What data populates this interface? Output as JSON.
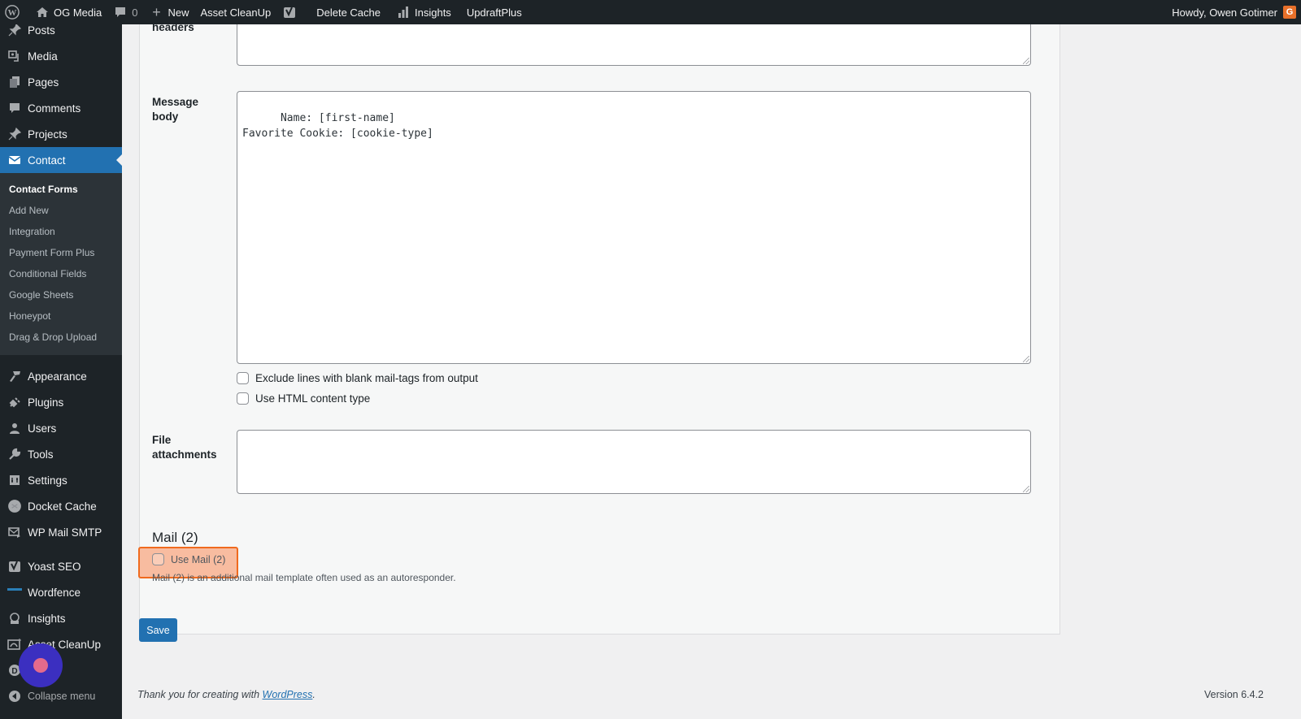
{
  "adminbar": {
    "site_name": "OG Media",
    "comments_count": "0",
    "new_label": "New",
    "asset_cleanup": "Asset CleanUp",
    "delete_cache": "Delete Cache",
    "insights": "Insights",
    "updraftplus": "UpdraftPlus",
    "howdy": "Howdy, Owen Gotimer",
    "avatar_letter": "G"
  },
  "sidebar": {
    "items_top": [
      {
        "label": "Posts",
        "icon": "pin-icon"
      },
      {
        "label": "Media",
        "icon": "media-icon"
      },
      {
        "label": "Pages",
        "icon": "pages-icon"
      },
      {
        "label": "Comments",
        "icon": "comment-icon"
      },
      {
        "label": "Projects",
        "icon": "pin-icon"
      },
      {
        "label": "Contact",
        "icon": "mail-icon",
        "active": true
      }
    ],
    "submenu": [
      {
        "label": "Contact Forms",
        "current": true
      },
      {
        "label": "Add New"
      },
      {
        "label": "Integration"
      },
      {
        "label": "Payment Form Plus"
      },
      {
        "label": "Conditional Fields"
      },
      {
        "label": "Google Sheets"
      },
      {
        "label": "Honeypot"
      },
      {
        "label": "Drag & Drop Upload"
      }
    ],
    "items_mid": [
      {
        "label": "Appearance",
        "icon": "brush-icon"
      },
      {
        "label": "Plugins",
        "icon": "plug-icon"
      },
      {
        "label": "Users",
        "icon": "user-icon"
      },
      {
        "label": "Tools",
        "icon": "wrench-icon"
      },
      {
        "label": "Settings",
        "icon": "settings-icon"
      },
      {
        "label": "Docket Cache",
        "icon": "docket-icon"
      },
      {
        "label": "WP Mail SMTP",
        "icon": "mail-smtp-icon"
      }
    ],
    "items_bottom": [
      {
        "label": "Yoast SEO",
        "icon": "yoast-icon"
      },
      {
        "label": "Wordfence",
        "icon": "wordfence-icon"
      },
      {
        "label": "Insights",
        "icon": "insights-icon"
      },
      {
        "label": "Asset CleanUp",
        "icon": "asset-cleanup-icon"
      },
      {
        "label": "",
        "icon": "d-icon"
      },
      {
        "label": "Collapse menu",
        "icon": "collapse-icon"
      }
    ]
  },
  "form": {
    "headers_label": "headers",
    "message_body_label_1": "Message",
    "message_body_label_2": "body",
    "message_body_value": "Name: [first-name]\nFavorite Cookie: [cookie-type]",
    "exclude_blank_label": "Exclude lines with blank mail-tags from output",
    "html_content_label": "Use HTML content type",
    "file_attachments_label_1": "File",
    "file_attachments_label_2": "attachments",
    "file_attachments_value": "",
    "mail2_title": "Mail (2)",
    "use_mail2_label": "Use Mail (2)",
    "mail2_description": "Mail (2) is an additional mail template often used as an autoresponder.",
    "save_label": "Save"
  },
  "footer": {
    "thanks_prefix": "Thank you for creating with ",
    "wordpress_link": "WordPress",
    "thanks_suffix": ".",
    "version": "Version 6.4.2"
  },
  "colors": {
    "accent": "#2271b1",
    "highlight": "#f06a1e"
  }
}
